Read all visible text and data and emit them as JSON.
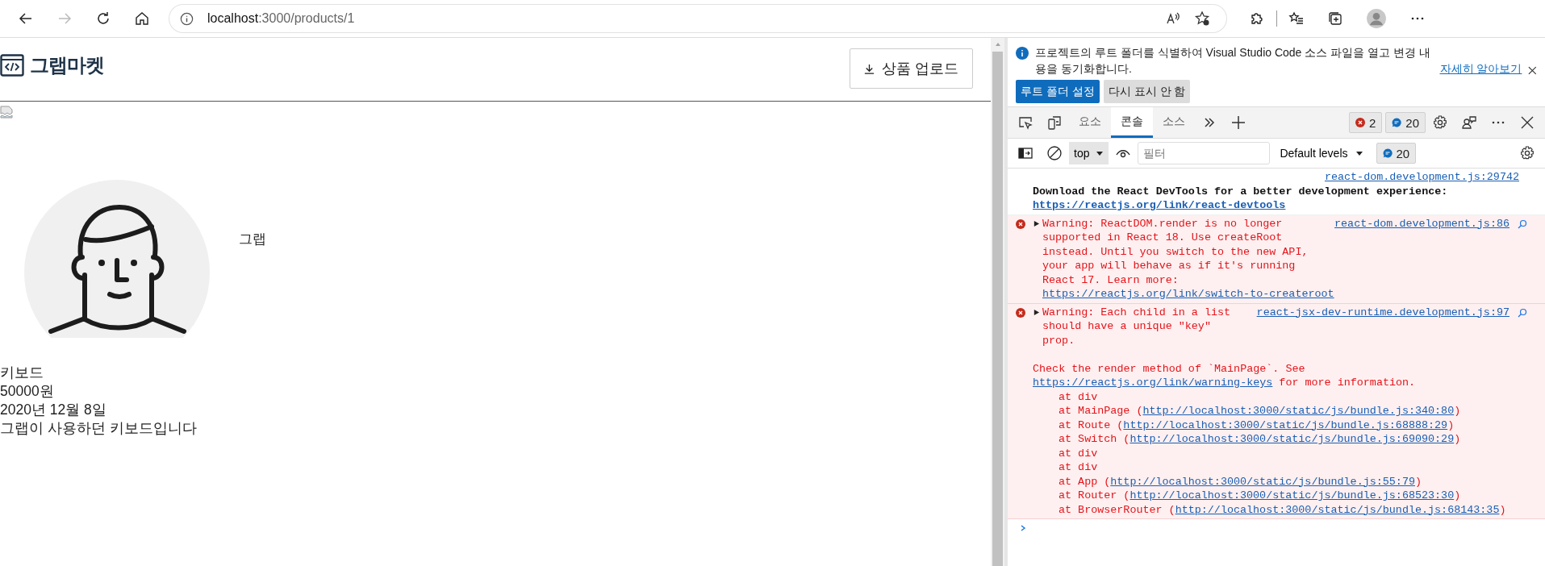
{
  "browser": {
    "url_host": "localhost",
    "url_path": ":3000/products/1"
  },
  "header": {
    "logo": "그랩마켓",
    "upload_button": "상품 업로드"
  },
  "product": {
    "seller": "그랩",
    "details": [
      "키보드",
      "50000원",
      "2020년 12월 8일",
      "그랩이 사용하던 키보드입니다"
    ]
  },
  "devtools": {
    "infobar": {
      "message": "프로젝트의 루트 폴더를 식별하여 Visual Studio Code 소스 파일을 열고 변경 내용을 동기화합니다.",
      "link": "자세히 알아보기",
      "buttons": [
        {
          "label": "루트 폴더 설정",
          "kind": "primary"
        },
        {
          "label": "다시 표시 안 함",
          "kind": "secondary"
        }
      ]
    },
    "tabs": [
      {
        "label": "요소",
        "selected": false
      },
      {
        "label": "콘솔",
        "selected": true
      },
      {
        "label": "소스",
        "selected": false
      }
    ],
    "error_count": "2",
    "message_count": "20",
    "console_toolbar": {
      "context": "top",
      "filter_placeholder": "필터",
      "levels": "Default levels",
      "message_count": "20"
    },
    "messages": [
      {
        "kind": "info",
        "source": "react-dom.development.js:29742",
        "paragraphs": [
          {
            "text": "Download the React DevTools for a better development experience: ",
            "link": "https://reactjs.org/link/react-devtools"
          }
        ]
      },
      {
        "kind": "error",
        "source": "react-dom.development.js:86",
        "paragraphs": [
          {
            "text": "Warning: ReactDOM.render is no longer supported in React 18. Use createRoot instead. Until you switch to the new API, your app will behave as if it's running React 17. Learn more: ",
            "link": "https://reactjs.org/link/switch-to-createroot"
          }
        ]
      },
      {
        "kind": "error",
        "source": "react-jsx-dev-runtime.development.js:97",
        "paragraphs": [
          {
            "text": "Warning: Each child in a list should have a unique \"key\" prop."
          },
          {
            "text": "Check the render method of `MainPage`. See ",
            "link": "https://reactjs.org/link/warning-keys",
            "after": " for more information."
          }
        ],
        "stack": [
          {
            "text": "at div"
          },
          {
            "text": "at MainPage (",
            "link": "http://localhost:3000/static/js/bundle.js:340:80",
            "after": ")"
          },
          {
            "text": "at Route (",
            "link": "http://localhost:3000/static/js/bundle.js:68888:29",
            "after": ")"
          },
          {
            "text": "at Switch (",
            "link": "http://localhost:3000/static/js/bundle.js:69090:29",
            "after": ")"
          },
          {
            "text": "at div"
          },
          {
            "text": "at div"
          },
          {
            "text": "at App (",
            "link": "http://localhost:3000/static/js/bundle.js:55:79",
            "after": ")"
          },
          {
            "text": "at Router (",
            "link": "http://localhost:3000/static/js/bundle.js:68523:30",
            "after": ")"
          },
          {
            "text": "at BrowserRouter (",
            "link": "http://localhost:3000/static/js/bundle.js:68143:35",
            "after": ")"
          }
        ]
      }
    ]
  }
}
